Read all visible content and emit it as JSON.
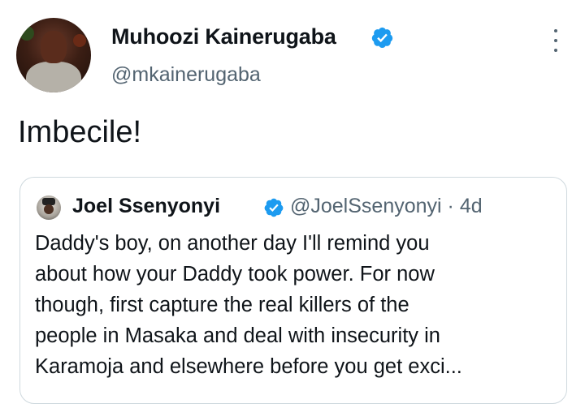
{
  "author": {
    "name": "Muhoozi Kainerugaba",
    "handle": "@mkainerugaba"
  },
  "tweet": {
    "text": "Imbecile!"
  },
  "quoted": {
    "name": "Joel Ssenyonyi",
    "handle": "@JoelSsenyonyi",
    "separator": "·",
    "time": "4d",
    "lines": [
      "Daddy's boy, on another day I'll remind you",
      "about how your Daddy took power. For now",
      "though, first capture the real killers of the",
      "people in Masaka and deal with insecurity in",
      "Karamoja and elsewhere before you get exci..."
    ]
  },
  "icons": {
    "verified": "verified-badge-icon",
    "more": "more-options-icon"
  },
  "colors": {
    "verified_blue": "#1d9bf0",
    "text_primary": "#0f1419",
    "text_secondary": "#536471",
    "border": "#cfd9de"
  }
}
